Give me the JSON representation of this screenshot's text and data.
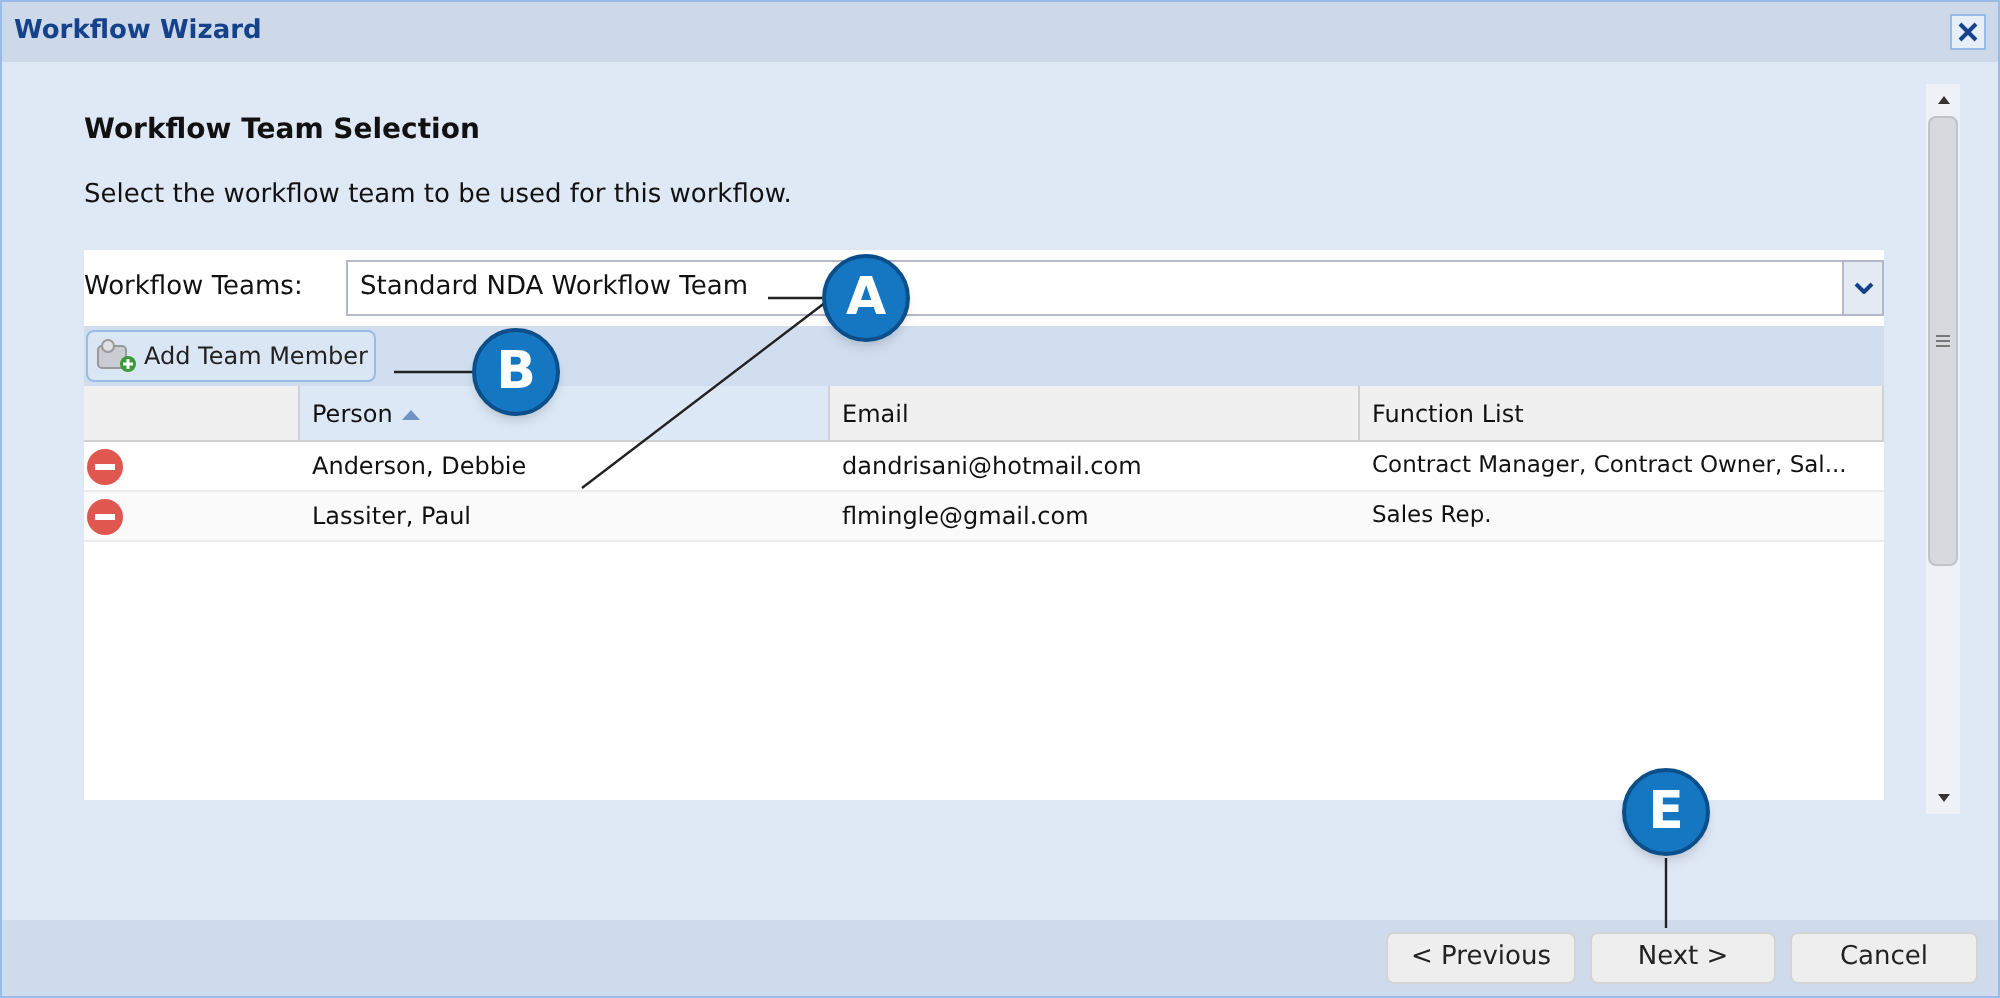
{
  "window": {
    "title": "Workflow Wizard"
  },
  "heading": "Workflow Team Selection",
  "instruction": "Select the workflow team to be used for this workflow.",
  "workflow_teams": {
    "label": "Workflow Teams:",
    "value": "Standard NDA Workflow Team"
  },
  "add_button": "Add Team Member",
  "table": {
    "columns": [
      {
        "sorted": false
      },
      {
        "label": "Person",
        "sorted": true
      },
      {
        "label": "Email",
        "sorted": false
      },
      {
        "label": "Function List",
        "sorted": false
      }
    ],
    "rows": [
      {
        "person": "Anderson, Debbie",
        "email": "dandrisani@hotmail.com",
        "functions": "Contract Manager, Contract Owner, Sal..."
      },
      {
        "person": "Lassiter, Paul",
        "email": "flmingle@gmail.com",
        "functions": "Sales Rep."
      }
    ]
  },
  "callouts": [
    "A",
    "B",
    "E"
  ],
  "buttons": [
    {
      "label": "< Previous",
      "kind": "previous"
    },
    {
      "label": "Next >",
      "kind": "next"
    },
    {
      "label": "Cancel",
      "kind": "cancel"
    }
  ]
}
